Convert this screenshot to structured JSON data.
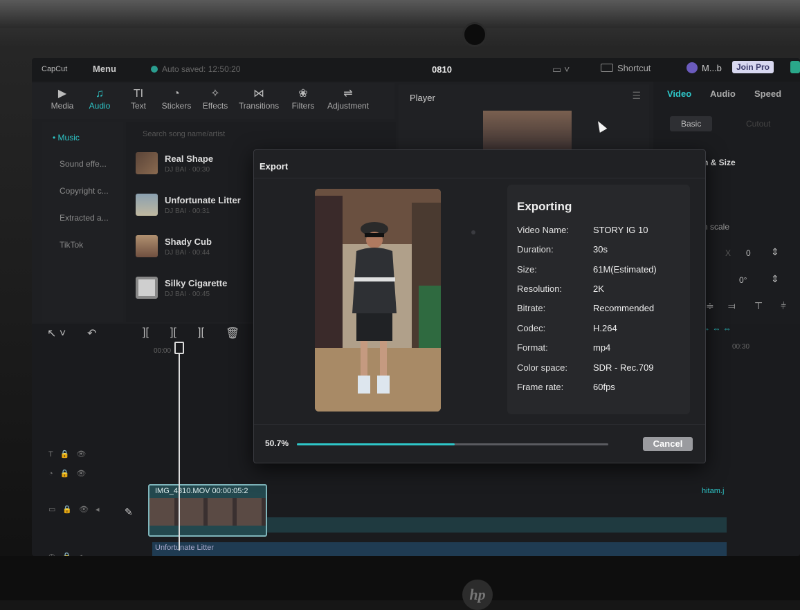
{
  "app": {
    "brand": "CapCut",
    "menu_label": "Menu",
    "autosave": "Auto saved: 12:50:20",
    "project_title": "0810",
    "shortcut_label": "Shortcut",
    "user_name": "M...b",
    "join_pro": "Join Pro"
  },
  "toolbar": {
    "items": [
      {
        "label": "Media",
        "icon": "media-icon",
        "glyph": "▶"
      },
      {
        "label": "Audio",
        "icon": "audio-icon",
        "glyph": "♫"
      },
      {
        "label": "Text",
        "icon": "text-icon",
        "glyph": "TI"
      },
      {
        "label": "Stickers",
        "icon": "stickers-icon",
        "glyph": "◔"
      },
      {
        "label": "Effects",
        "icon": "effects-icon",
        "glyph": "✧"
      },
      {
        "label": "Transitions",
        "icon": "transitions-icon",
        "glyph": "⋈"
      },
      {
        "label": "Filters",
        "icon": "filters-icon",
        "glyph": "❀"
      },
      {
        "label": "Adjustment",
        "icon": "adjustment-icon",
        "glyph": "⇌"
      }
    ],
    "active": "Audio"
  },
  "categories": [
    "Music",
    "Sound effe...",
    "Copyright c...",
    "Extracted a...",
    "TikTok"
  ],
  "music": {
    "search_placeholder": "Search song name/artist",
    "songs": [
      {
        "name": "Real Shape",
        "meta": "DJ BAI · 00:30"
      },
      {
        "name": "Unfortunate Litter",
        "meta": "DJ BAI · 00:31"
      },
      {
        "name": "Shady Cub",
        "meta": "DJ BAI · 00:44"
      },
      {
        "name": "Silky Cigarette",
        "meta": "DJ BAI · 00:45"
      }
    ]
  },
  "player": {
    "title": "Player"
  },
  "right_panel": {
    "tabs": [
      "Video",
      "Audio",
      "Speed"
    ],
    "subtabs": [
      "Basic",
      "Cutout"
    ],
    "section": "n & Size",
    "scale_label": "n scale",
    "x_label": "X",
    "x_value": "0",
    "rotation": "0°"
  },
  "timeline": {
    "ruler_start": "00:00",
    "ruler_end": "00:30",
    "clip_label": "IMG_4310.MOV   00:00:05:2",
    "clip_right": "hitam.j",
    "audio_label": "Unfortunate Litter"
  },
  "export": {
    "title": "Export",
    "status": "Exporting",
    "fields": [
      {
        "k": "Video Name:",
        "v": "STORY IG 10"
      },
      {
        "k": "Duration:",
        "v": "30s"
      },
      {
        "k": "Size:",
        "v": "61M(Estimated)"
      },
      {
        "k": "Resolution:",
        "v": "2K"
      },
      {
        "k": "Bitrate:",
        "v": "Recommended"
      },
      {
        "k": "Codec:",
        "v": "H.264"
      },
      {
        "k": "Format:",
        "v": "mp4"
      },
      {
        "k": "Color space:",
        "v": "SDR - Rec.709"
      },
      {
        "k": "Frame rate:",
        "v": "60fps"
      }
    ],
    "progress_label": "50.7%",
    "progress": 0.507,
    "cancel_label": "Cancel"
  },
  "colors": {
    "accent": "#2ec6c8",
    "background": "#1e1f22"
  },
  "hp_logo": "hp"
}
